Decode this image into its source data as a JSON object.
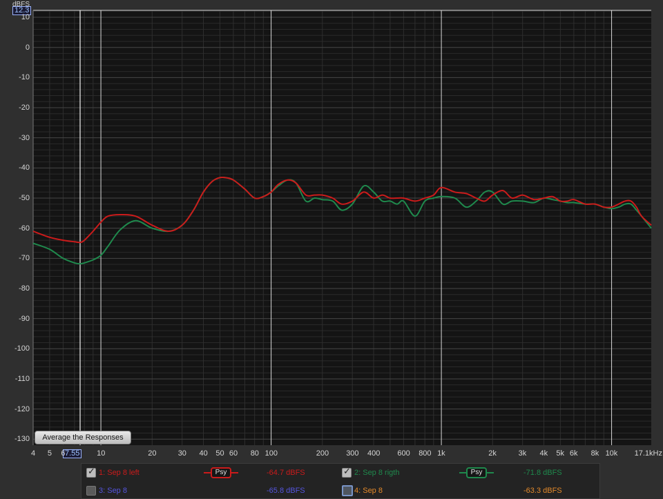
{
  "app": {
    "title": ""
  },
  "y_axis": {
    "unit": "dBFS",
    "cursor_readout": "12.3",
    "ticks": [
      "10",
      "0",
      "-10",
      "-20",
      "-30",
      "-40",
      "-50",
      "-60",
      "-70",
      "-80",
      "-90",
      "-100",
      "-110",
      "-120",
      "-130"
    ]
  },
  "x_axis": {
    "cursor_readout": "7.55",
    "ticks": [
      "4",
      "5",
      "6",
      "10",
      "20",
      "30",
      "40",
      "50",
      "60",
      "80",
      "100",
      "200",
      "300",
      "400",
      "600",
      "800",
      "1k",
      "2k",
      "3k",
      "4k",
      "5k",
      "6k",
      "8k",
      "10k",
      "17.1kHz"
    ]
  },
  "buttons": {
    "average_label": "Average the Responses"
  },
  "legend": {
    "items": [
      {
        "label": "1: Sep 8 left",
        "checked": true,
        "value": "-64.7 dBFS",
        "color": "#cc1b1b",
        "psy": "Psy"
      },
      {
        "label": "2: Sep 8 rigth",
        "checked": true,
        "value": "-71.8 dBFS",
        "color": "#1f8a4d",
        "psy": "Psy"
      },
      {
        "label": "3: Sep 8",
        "checked": false,
        "value": "-65.8 dBFS",
        "color": "#5555e0"
      },
      {
        "label": "4: Sep 8",
        "checked": false,
        "value": "-63.3 dBFS",
        "color": "#e58a2a"
      }
    ]
  },
  "chart_data": {
    "type": "line",
    "xscale": "log",
    "xlim": [
      4,
      17100
    ],
    "ylim": [
      -132,
      12.3
    ],
    "grid": true,
    "ylabel": "dBFS",
    "xlabel": "kHz",
    "cursor": {
      "x": 7.55
    },
    "series": [
      {
        "name": "1: Sep 8 left",
        "color": "#cc1b1b",
        "points": [
          [
            4,
            -61
          ],
          [
            5,
            -63
          ],
          [
            6,
            -64
          ],
          [
            7,
            -64.5
          ],
          [
            7.55,
            -64.7
          ],
          [
            8,
            -64
          ],
          [
            9,
            -61
          ],
          [
            10,
            -58
          ],
          [
            11,
            -56
          ],
          [
            13,
            -55.5
          ],
          [
            16,
            -56
          ],
          [
            20,
            -59
          ],
          [
            25,
            -61
          ],
          [
            30,
            -59
          ],
          [
            35,
            -54
          ],
          [
            40,
            -48
          ],
          [
            45,
            -44.5
          ],
          [
            50,
            -43.2
          ],
          [
            55,
            -43.3
          ],
          [
            60,
            -44
          ],
          [
            70,
            -47
          ],
          [
            80,
            -50
          ],
          [
            90,
            -49.5
          ],
          [
            100,
            -48
          ],
          [
            110,
            -45.5
          ],
          [
            125,
            -44
          ],
          [
            140,
            -45
          ],
          [
            160,
            -49
          ],
          [
            180,
            -49
          ],
          [
            200,
            -49
          ],
          [
            230,
            -50
          ],
          [
            260,
            -52
          ],
          [
            300,
            -51
          ],
          [
            350,
            -48
          ],
          [
            400,
            -50
          ],
          [
            450,
            -49
          ],
          [
            500,
            -50
          ],
          [
            550,
            -50
          ],
          [
            600,
            -50
          ],
          [
            700,
            -51
          ],
          [
            800,
            -50
          ],
          [
            900,
            -49
          ],
          [
            1000,
            -46.5
          ],
          [
            1200,
            -48
          ],
          [
            1400,
            -48.5
          ],
          [
            1600,
            -50
          ],
          [
            1800,
            -51
          ],
          [
            2000,
            -49
          ],
          [
            2300,
            -47.5
          ],
          [
            2600,
            -50
          ],
          [
            3000,
            -49
          ],
          [
            3500,
            -50.5
          ],
          [
            4000,
            -50
          ],
          [
            4500,
            -49.5
          ],
          [
            5000,
            -51
          ],
          [
            5500,
            -51
          ],
          [
            6000,
            -50.5
          ],
          [
            7000,
            -52
          ],
          [
            8000,
            -52
          ],
          [
            9000,
            -53
          ],
          [
            10000,
            -53
          ],
          [
            11000,
            -52
          ],
          [
            12000,
            -51
          ],
          [
            13000,
            -51
          ],
          [
            14000,
            -53
          ],
          [
            15000,
            -56
          ],
          [
            17100,
            -59
          ]
        ]
      },
      {
        "name": "2: Sep 8 rigth",
        "color": "#1f8a4d",
        "points": [
          [
            4,
            -65
          ],
          [
            5,
            -67
          ],
          [
            6,
            -70
          ],
          [
            7,
            -71.5
          ],
          [
            7.55,
            -71.8
          ],
          [
            8,
            -71.5
          ],
          [
            9,
            -70.5
          ],
          [
            10,
            -69
          ],
          [
            11,
            -66
          ],
          [
            13,
            -60.5
          ],
          [
            16,
            -57.5
          ],
          [
            20,
            -60
          ],
          [
            25,
            -61
          ],
          [
            30,
            -59
          ],
          [
            35,
            -54
          ],
          [
            40,
            -48
          ],
          [
            45,
            -44.5
          ],
          [
            50,
            -43.2
          ],
          [
            55,
            -43.3
          ],
          [
            60,
            -44
          ],
          [
            70,
            -47
          ],
          [
            80,
            -50
          ],
          [
            90,
            -49.5
          ],
          [
            100,
            -48
          ],
          [
            110,
            -46
          ],
          [
            125,
            -44
          ],
          [
            140,
            -45
          ],
          [
            160,
            -51
          ],
          [
            180,
            -50
          ],
          [
            200,
            -50.5
          ],
          [
            230,
            -51
          ],
          [
            260,
            -54
          ],
          [
            300,
            -52
          ],
          [
            350,
            -46
          ],
          [
            400,
            -48
          ],
          [
            450,
            -51
          ],
          [
            500,
            -51
          ],
          [
            550,
            -52
          ],
          [
            600,
            -51
          ],
          [
            700,
            -56
          ],
          [
            800,
            -51
          ],
          [
            900,
            -50
          ],
          [
            1000,
            -49.5
          ],
          [
            1200,
            -50
          ],
          [
            1400,
            -53
          ],
          [
            1600,
            -51
          ],
          [
            1800,
            -48
          ],
          [
            2000,
            -48
          ],
          [
            2300,
            -52
          ],
          [
            2600,
            -51
          ],
          [
            3000,
            -51
          ],
          [
            3500,
            -51.5
          ],
          [
            4000,
            -50
          ],
          [
            4500,
            -50.5
          ],
          [
            5000,
            -51
          ],
          [
            5500,
            -51.5
          ],
          [
            6000,
            -51.5
          ],
          [
            7000,
            -52
          ],
          [
            8000,
            -52
          ],
          [
            9000,
            -53
          ],
          [
            10000,
            -53.5
          ],
          [
            11000,
            -53
          ],
          [
            12000,
            -52
          ],
          [
            13000,
            -52
          ],
          [
            14000,
            -54
          ],
          [
            15000,
            -56
          ],
          [
            17100,
            -60
          ]
        ]
      }
    ]
  }
}
